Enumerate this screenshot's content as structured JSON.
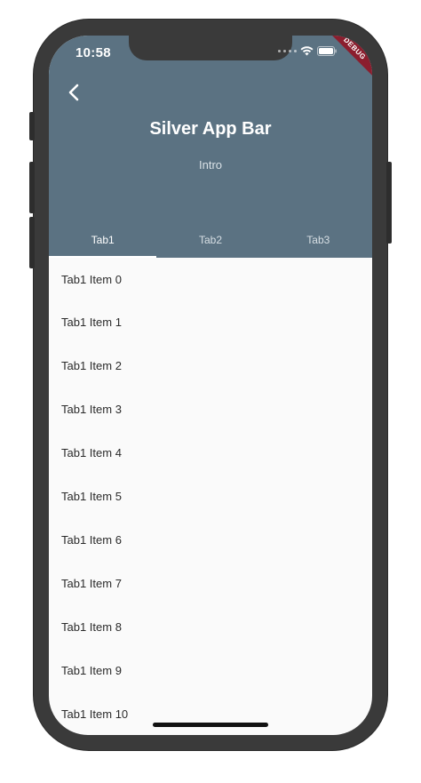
{
  "status_bar": {
    "time": "10:58",
    "debug_label": "DEBUG"
  },
  "app_bar": {
    "title": "Silver App Bar",
    "subtitle": "Intro",
    "background_color": "#5b7282"
  },
  "tabs": [
    {
      "label": "Tab1",
      "active": true
    },
    {
      "label": "Tab2",
      "active": false
    },
    {
      "label": "Tab3",
      "active": false
    }
  ],
  "list_items": [
    "Tab1 Item 0",
    "Tab1 Item 1",
    "Tab1 Item 2",
    "Tab1 Item 3",
    "Tab1 Item 4",
    "Tab1 Item 5",
    "Tab1 Item 6",
    "Tab1 Item 7",
    "Tab1 Item 8",
    "Tab1 Item 9",
    "Tab1 Item 10"
  ],
  "icons": {
    "back": "chevron-left-icon",
    "wifi": "wifi-icon",
    "battery": "battery-icon"
  }
}
